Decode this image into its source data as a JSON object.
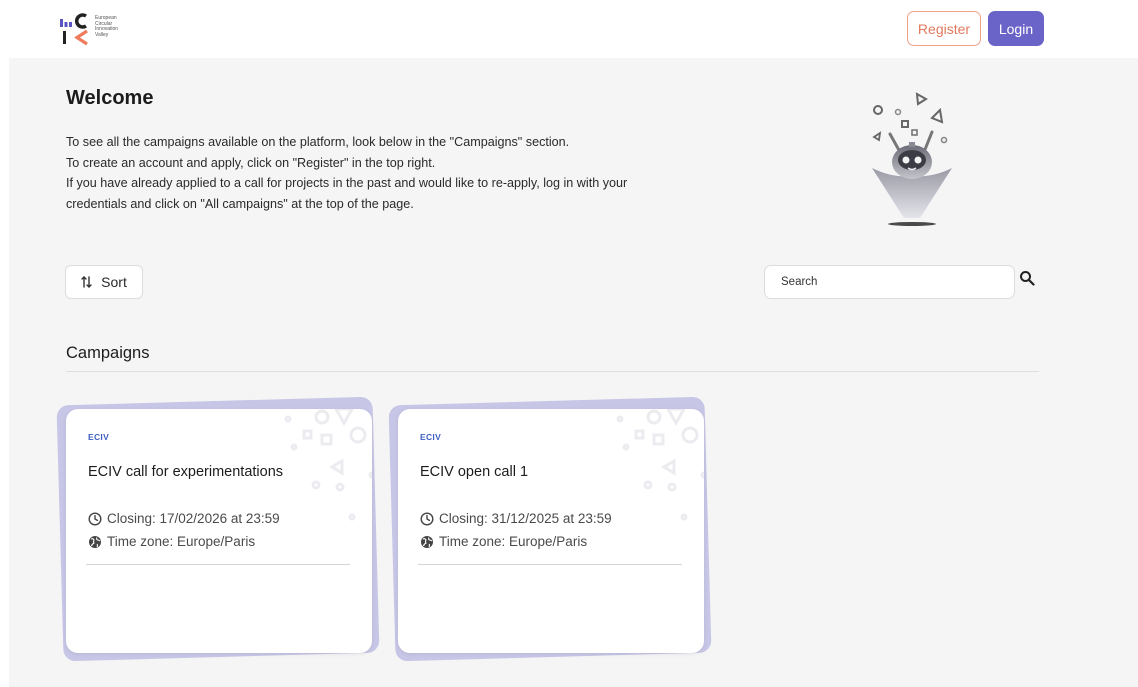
{
  "header": {
    "logo_text": "European\nCircular\nInnovation\nValley",
    "logo_letters": [
      "E",
      "C",
      "I",
      "V"
    ],
    "register_label": "Register",
    "login_label": "Login",
    "colors": {
      "register": "#e2795e",
      "login": "#6a63c8"
    }
  },
  "welcome": {
    "title": "Welcome",
    "lines": [
      "To see all the campaigns available on the platform, look below in the \"Campaigns\" section.",
      "To create an account and apply, click on \"Register\" in the top right.",
      "If you have already applied to a call for projects in the past and would like to re-apply, log in with your",
      "credentials and click on \"All campaigns\" at the top of the page."
    ]
  },
  "toolbar": {
    "sort_label": "Sort",
    "search_placeholder": "Search",
    "icons": {
      "sort": "sort-arrows-icon",
      "search": "search-icon"
    }
  },
  "campaigns": {
    "title": "Campaigns",
    "items": [
      {
        "tag": "ECIV",
        "title": "ECIV call for experimentations",
        "closing": "Closing: 17/02/2026 at 23:59",
        "timezone": "Time zone: Europe/Paris"
      },
      {
        "tag": "ECIV",
        "title": "ECIV open call 1",
        "closing": "Closing: 31/12/2025 at 23:59",
        "timezone": "Time zone: Europe/Paris"
      }
    ]
  }
}
